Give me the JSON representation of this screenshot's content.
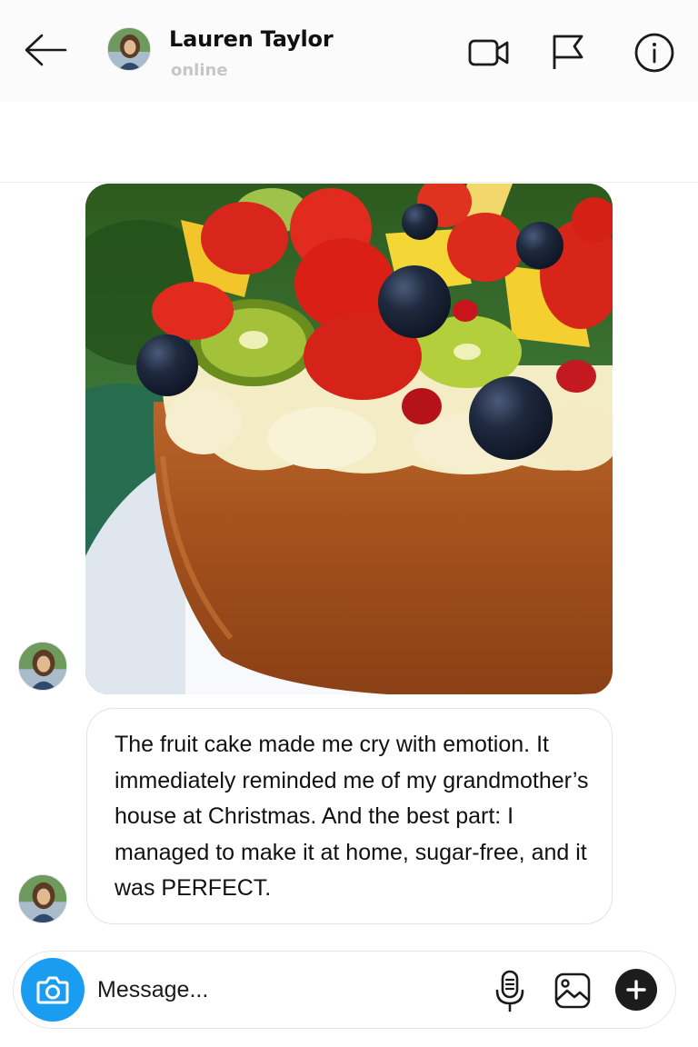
{
  "header": {
    "contact_name": "Lauren Taylor",
    "status": "online",
    "icons": {
      "back": "arrow-left-icon",
      "video": "video-camera-icon",
      "flag": "flag-icon",
      "info": "info-icon"
    }
  },
  "conversation": {
    "photo_message": {
      "icon": "image-message",
      "sender": "Lauren Taylor"
    },
    "text_message": {
      "text": "The fruit cake made me cry with emotion. It immediately reminded me of my grandmother’s house at Christmas. And the best part: I managed to make it at home, sugar-free, and it was PERFECT."
    }
  },
  "composer": {
    "placeholder": "Message...",
    "icons": {
      "camera": "camera-icon",
      "mic": "microphone-icon",
      "gallery": "gallery-icon",
      "add": "plus-icon"
    },
    "accent_color": "#1a9df0"
  }
}
